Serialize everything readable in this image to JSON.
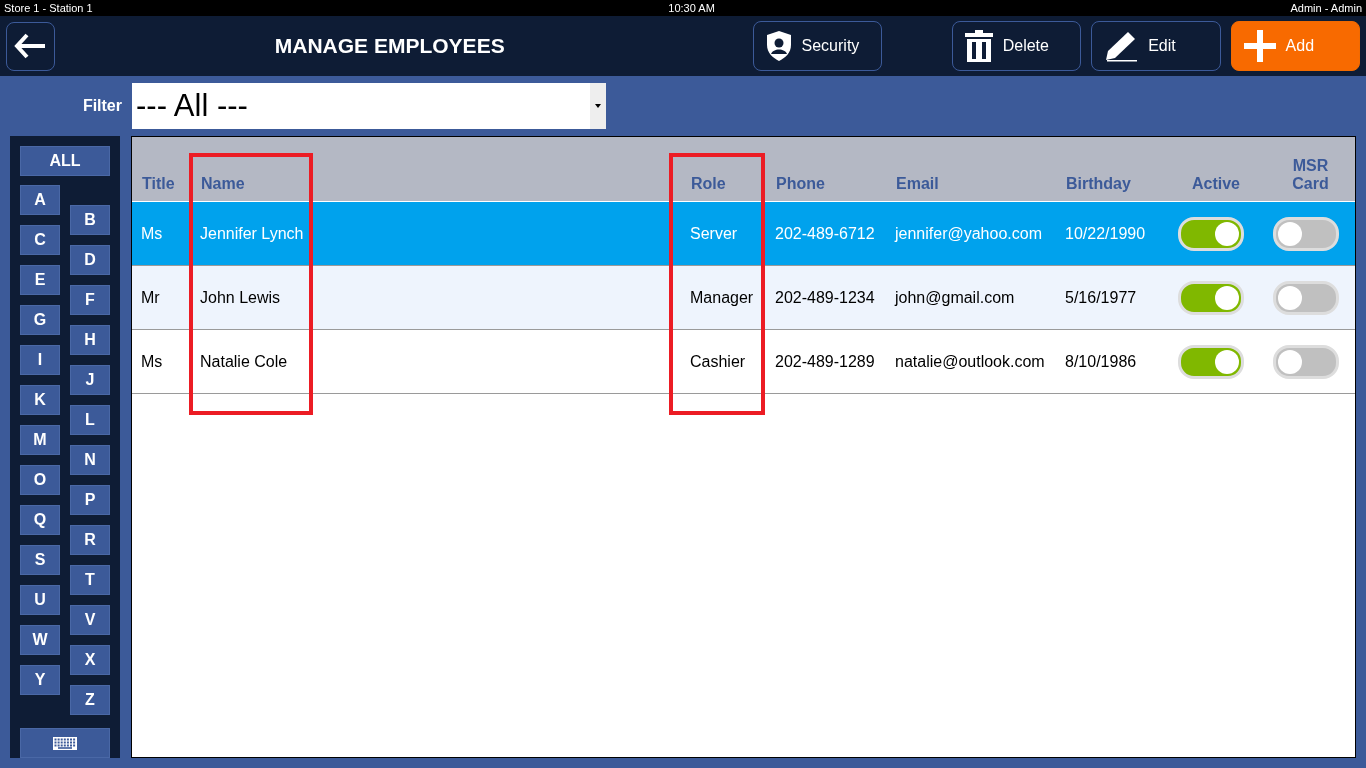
{
  "status_bar": {
    "left": "Store 1 - Station 1",
    "center": "10:30 AM",
    "right": "Admin - Admin"
  },
  "header": {
    "title": "MANAGE EMPLOYEES",
    "buttons": [
      {
        "kind": "security",
        "label": "Security"
      },
      {
        "kind": "delete",
        "label": "Delete"
      },
      {
        "kind": "edit",
        "label": "Edit"
      },
      {
        "kind": "add",
        "label": "Add"
      }
    ]
  },
  "filter": {
    "label": "Filter",
    "value": "--- All ---"
  },
  "letters": {
    "all": "ALL",
    "items": [
      "A",
      "B",
      "C",
      "D",
      "E",
      "F",
      "G",
      "H",
      "I",
      "J",
      "K",
      "L",
      "M",
      "N",
      "O",
      "P",
      "Q",
      "R",
      "S",
      "T",
      "U",
      "V",
      "W",
      "X",
      "Y",
      "Z"
    ]
  },
  "table": {
    "columns": [
      {
        "label": "Title",
        "highlighted": false
      },
      {
        "label": "Name",
        "highlighted": true
      },
      {
        "label": "Role",
        "highlighted": true
      },
      {
        "label": "Phone",
        "highlighted": false
      },
      {
        "label": "Email",
        "highlighted": false
      },
      {
        "label": "Birthday",
        "highlighted": false
      },
      {
        "label": "Active",
        "highlighted": false
      },
      {
        "label": "MSR Card",
        "highlighted": false
      }
    ],
    "rows": [
      {
        "selected": true,
        "title": "Ms",
        "name": "Jennifer Lynch",
        "role": "Server",
        "phone": "202-489-6712",
        "email": "jennifer@yahoo.com",
        "birthday": "10/22/1990",
        "active": true,
        "msr_card": false
      },
      {
        "selected": false,
        "title": "Mr",
        "name": "John Lewis",
        "role": "Manager",
        "phone": "202-489-1234",
        "email": "john@gmail.com",
        "birthday": "5/16/1977",
        "active": true,
        "msr_card": false
      },
      {
        "selected": false,
        "title": "Ms",
        "name": "Natalie Cole",
        "role": "Cashier",
        "phone": "202-489-1289",
        "email": "natalie@outlook.com",
        "birthday": "8/10/1986",
        "active": true,
        "msr_card": false
      }
    ]
  }
}
